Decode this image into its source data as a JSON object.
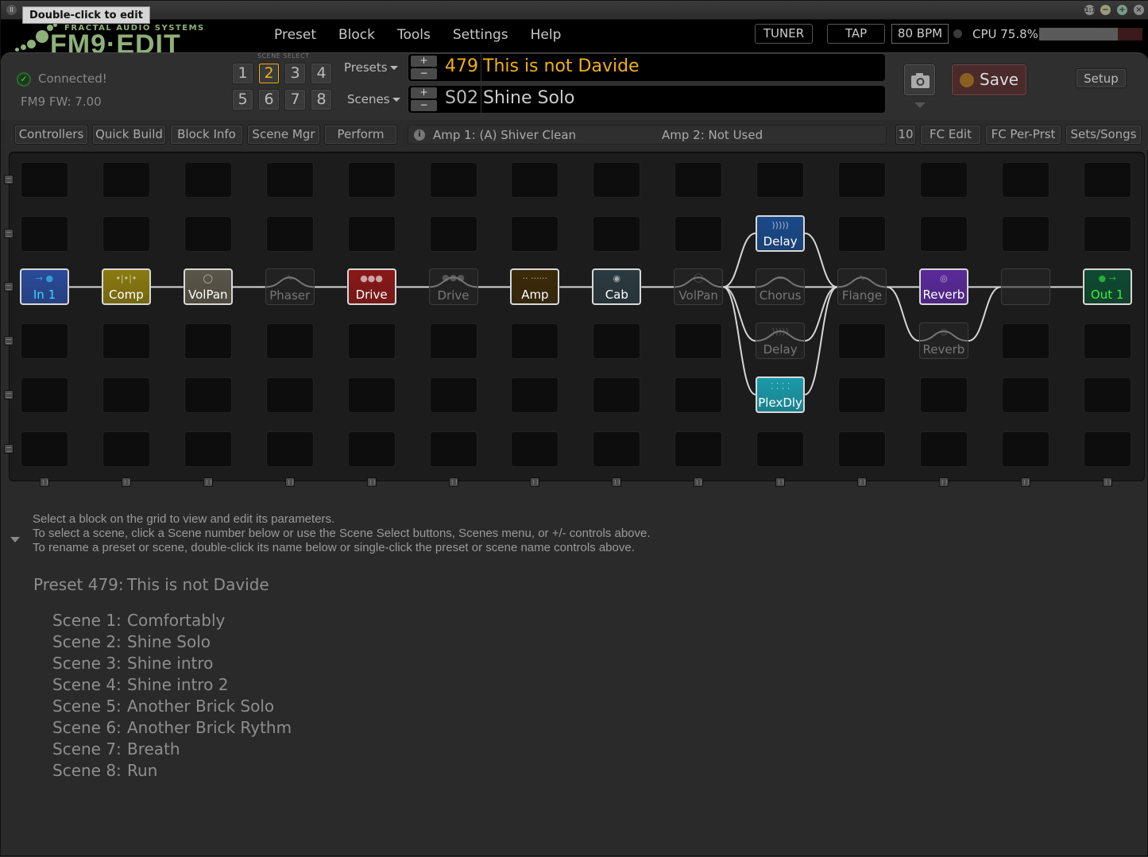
{
  "window": {
    "tooltip": "Double-click to edit",
    "controls": [
      "restore",
      "minimize",
      "maximize",
      "close"
    ]
  },
  "logo": {
    "sub": "FRACTAL AUDIO SYSTEMS",
    "main": "FM9·EDIT"
  },
  "menu": [
    "Preset",
    "Block",
    "Tools",
    "Settings",
    "Help"
  ],
  "header": {
    "tuner_label": "TUNER",
    "tap_label": "TAP",
    "bpm": "80 BPM",
    "cpu_label": "CPU 75.8%",
    "cpu_percent": 75.8
  },
  "status": {
    "connected": "Connected!",
    "firmware": "FM9 FW: 7.00"
  },
  "scene_select": {
    "label": "SCENE SELECT",
    "buttons": [
      "1",
      "2",
      "3",
      "4",
      "5",
      "6",
      "7",
      "8"
    ],
    "active": "2"
  },
  "preset": {
    "menu_label": "Presets",
    "number": "479",
    "name": "This is not Davide",
    "color": "#f2b012"
  },
  "scene": {
    "menu_label": "Scenes",
    "number": "S02",
    "name": "Shine Solo"
  },
  "toolbar": {
    "save_label": "Save",
    "setup_label": "Setup",
    "camera_icon": "camera-icon"
  },
  "tabs_left": [
    "Controllers",
    "Quick Build",
    "Block Info",
    "Scene Mgr",
    "Perform"
  ],
  "amp_info": {
    "amp1": "Amp 1: (A) Shiver Clean",
    "amp2": "Amp 2: Not Used"
  },
  "tabs_right": [
    "10",
    "FC Edit",
    "FC Per-Prst",
    "Sets/Songs"
  ],
  "grid": {
    "columns": 14,
    "rows": 6,
    "blocks": [
      {
        "label": "In 1",
        "col": 0,
        "row": 2,
        "bypassed": false,
        "color": "#2a4a9a",
        "text_color": "#39d6ff",
        "icon": "input-arrow-icon"
      },
      {
        "label": "Comp",
        "col": 1,
        "row": 2,
        "bypassed": false,
        "color": "#8a7a10",
        "text_color": "#ffffff",
        "icon": "compressor-meter-icon"
      },
      {
        "label": "VolPan",
        "col": 2,
        "row": 2,
        "bypassed": false,
        "color": "#5a5648",
        "text_color": "#ffffff",
        "icon": "volume-knob-icon"
      },
      {
        "label": "Phaser",
        "col": 3,
        "row": 2,
        "bypassed": true,
        "icon": "phaser-icon"
      },
      {
        "label": "Drive",
        "col": 4,
        "row": 2,
        "bypassed": false,
        "color": "#8a1818",
        "text_color": "#ffffff",
        "icon": "drive-knobs-icon"
      },
      {
        "label": "Drive",
        "col": 5,
        "row": 2,
        "bypassed": true,
        "icon": "drive-knobs-icon"
      },
      {
        "label": "Amp",
        "col": 6,
        "row": 2,
        "bypassed": false,
        "color": "#3a2a08",
        "text_color": "#ffffff",
        "icon": "amp-head-icon"
      },
      {
        "label": "Cab",
        "col": 7,
        "row": 2,
        "bypassed": false,
        "color": "#2a3a40",
        "text_color": "#ffffff",
        "icon": "speaker-icon"
      },
      {
        "label": "VolPan",
        "col": 8,
        "row": 2,
        "bypassed": true,
        "icon": "volume-knob-icon"
      },
      {
        "label": "Delay",
        "col": 9,
        "row": 1,
        "bypassed": false,
        "color": "#1a4a8a",
        "text_color": "#ffffff",
        "icon": "delay-echo-icon"
      },
      {
        "label": "Chorus",
        "col": 9,
        "row": 2,
        "bypassed": true,
        "icon": "chorus-icon"
      },
      {
        "label": "Delay",
        "col": 9,
        "row": 3,
        "bypassed": true,
        "icon": "delay-echo-icon"
      },
      {
        "label": "PlexDly",
        "col": 9,
        "row": 4,
        "bypassed": false,
        "color": "#1a9aaa",
        "text_color": "#ffffff",
        "icon": "plex-delay-icon"
      },
      {
        "label": "Flange",
        "col": 10,
        "row": 2,
        "bypassed": true,
        "icon": "flanger-icon"
      },
      {
        "label": "Reverb",
        "col": 11,
        "row": 2,
        "bypassed": false,
        "color": "#5a2a9a",
        "text_color": "#ffffff",
        "icon": "reverb-ripple-icon"
      },
      {
        "label": "Reverb",
        "col": 11,
        "row": 3,
        "bypassed": true,
        "icon": "reverb-ripple-icon"
      },
      {
        "label": "",
        "col": 12,
        "row": 2,
        "bypassed": true,
        "icon": "shunt-icon"
      },
      {
        "label": "Out 1",
        "col": 13,
        "row": 2,
        "bypassed": false,
        "color": "#0f4a32",
        "text_color": "#3cf03c",
        "icon": "output-arrow-icon"
      }
    ]
  },
  "help": {
    "lines": [
      "Select a block on the grid to view and edit its parameters.",
      "To select a scene, click a Scene number below or use the Scene Select buttons, Scenes menu, or +/- controls above.",
      "To rename a preset or scene, double-click its name below or single-click the preset or scene name controls above."
    ]
  },
  "summary": {
    "preset_key": "Preset 479:",
    "preset_name": "This is not Davide",
    "scenes": [
      {
        "key": "Scene 1:",
        "name": "Comfortably"
      },
      {
        "key": "Scene 2:",
        "name": "Shine Solo"
      },
      {
        "key": "Scene 3:",
        "name": "Shine intro"
      },
      {
        "key": "Scene 4:",
        "name": "Shine intro 2"
      },
      {
        "key": "Scene 5:",
        "name": "Another Brick Solo"
      },
      {
        "key": "Scene 6:",
        "name": "Another Brick Rythm"
      },
      {
        "key": "Scene 7:",
        "name": "Breath"
      },
      {
        "key": "Scene 8:",
        "name": "Run"
      }
    ]
  }
}
